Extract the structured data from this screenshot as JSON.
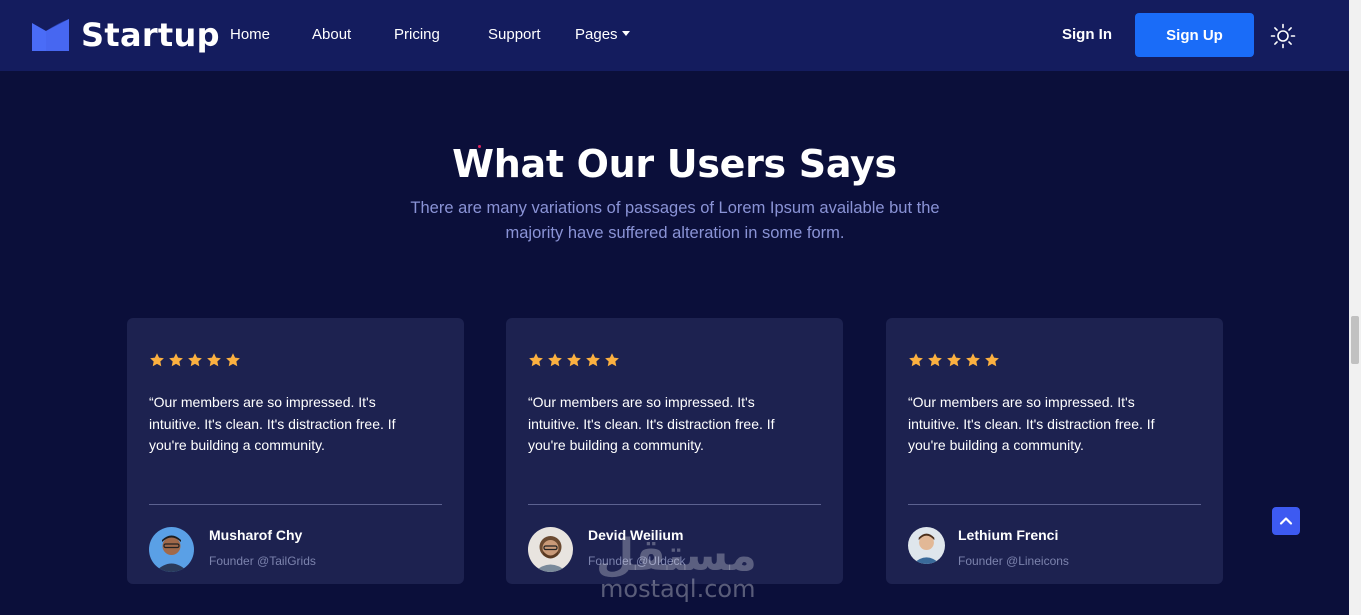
{
  "header": {
    "brand": "Startup",
    "nav": [
      {
        "label": "Home"
      },
      {
        "label": "About"
      },
      {
        "label": "Pricing"
      },
      {
        "label": "Support"
      },
      {
        "label": "Pages"
      }
    ],
    "sign_in": "Sign In",
    "sign_up": "Sign Up",
    "icons": {
      "logo": "startup-logo-icon",
      "theme": "sun-icon",
      "dropdown": "caret-down-icon"
    }
  },
  "section": {
    "title": "What Our Users Says",
    "subtitle": "There are many variations of passages of Lorem Ipsum available but the majority have suffered alteration in some form."
  },
  "testimonials": [
    {
      "rating": 5,
      "quote": "“Our members are so impressed. It's intuitive. It's clean. It's distraction free. If you're building a community.",
      "name": "Musharof Chy",
      "role": "Founder @TailGrids"
    },
    {
      "rating": 5,
      "quote": "“Our members are so impressed. It's intuitive. It's clean. It's distraction free. If you're building a community.",
      "name": "Devid Weilium",
      "role": "Founder @UIdeck"
    },
    {
      "rating": 5,
      "quote": "“Our members are so impressed. It's intuitive. It's clean. It's distraction free. If you're building a community.",
      "name": "Lethium Frenci",
      "role": "Founder @Lineicons"
    }
  ],
  "watermark": {
    "arabic": "مستقل",
    "latin": "mostaql.com"
  },
  "colors": {
    "background": "#0b0f3a",
    "header": "#141c5e",
    "card": "#1d2250",
    "primary": "#1a6cf8",
    "star": "#fbb040",
    "subtitle": "#8a93d6"
  }
}
